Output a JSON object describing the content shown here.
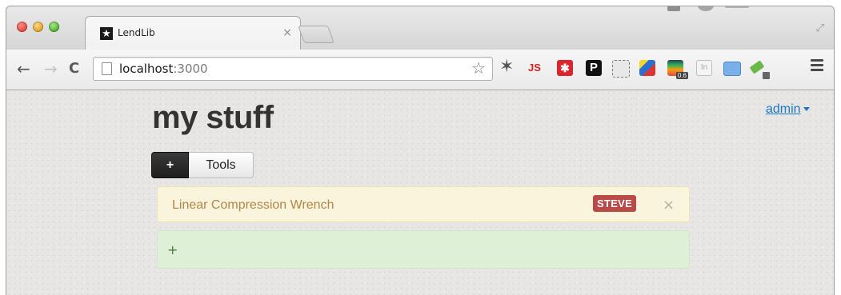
{
  "browser": {
    "tab": {
      "favicon": "★",
      "title": "LendLib",
      "close": "×"
    },
    "omnibox": {
      "host": "localhost",
      "port": ":3000"
    },
    "extensions": {
      "js_label": "JS",
      "pinterest": "P",
      "lastpass": "✱",
      "badge_count": "0.6",
      "linkedin": "In"
    },
    "fullscreen": "⤢"
  },
  "page": {
    "title": "my stuff",
    "user_menu": "admin",
    "add_button": "+",
    "category_button": "Tools",
    "items": [
      {
        "name": "Linear Compression Wrench",
        "lent_to": "STEVE",
        "remove": "×"
      }
    ],
    "add_item": "+"
  }
}
